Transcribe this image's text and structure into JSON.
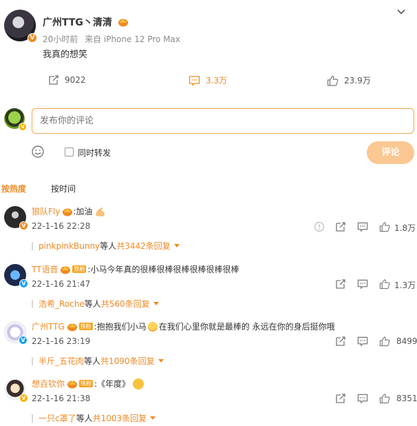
{
  "post": {
    "author": "广州TTG丶清清",
    "time": "20小时前",
    "source": "来自 iPhone 12 Pro Max",
    "text": "我真的想笑",
    "reposts": "9022",
    "comments": "3.3万",
    "likes": "23.9万"
  },
  "compose": {
    "placeholder": "发布你的评论",
    "repost_label": "同时转发",
    "submit_label": "评论"
  },
  "tabs": {
    "hot": "按热度",
    "time": "按时间"
  },
  "comments": [
    {
      "name": "狼队Fly",
      "text": ":加油",
      "time": "22-1-16 22:28",
      "likes": "1.8万",
      "reply_users": "pinkpinkBunny",
      "reply_mid": " 等人 ",
      "reply_count": "共3442条回复",
      "badge": "V"
    },
    {
      "name": "TT语音",
      "tag": "铁粉",
      "text": ":小马今年真的很棒很棒很棒很棒很棒很棒",
      "time": "22-1-16 21:47",
      "likes": "1.3万",
      "reply_users": "浩希_Roche",
      "reply_mid": " 等人 ",
      "reply_count": "共560条回复",
      "badge": "V"
    },
    {
      "name": "广州TTG",
      "tag": "铁粉",
      "text": ":抱抱我们小马",
      "text2": "在我们心里你就是最棒的 永远在你的身后挺你哦",
      "time": "22-1-16 23:19",
      "likes": "8499",
      "reply_users": "半斤_五花肉",
      "reply_mid": " 等人 ",
      "reply_count": "共1090条回复",
      "badge": "V"
    },
    {
      "name": "想垚钦你",
      "tag": "铁粉",
      "text": ":《年度》",
      "time": "22-1-16 21:38",
      "likes": "8351",
      "reply_users": "一只c罩了",
      "reply_mid": " 等人 ",
      "reply_count": "共1003条回复",
      "badge": "V"
    }
  ],
  "colors": {
    "accent": "#f08a24",
    "submit_bg": "#fbc792",
    "input_border": "#f2a451"
  }
}
